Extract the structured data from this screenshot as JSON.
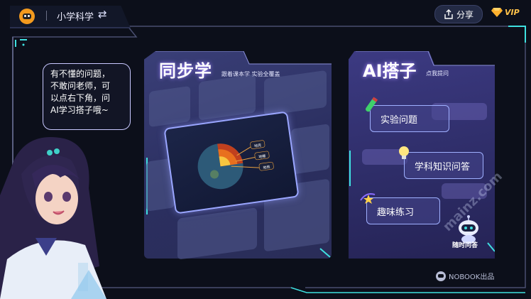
{
  "header": {
    "title": "小学科学",
    "swap_icon": "⇄",
    "share_label": "分享",
    "vip_label": "VIP"
  },
  "bubble": {
    "text": "有不懂的问题，\n不敢问老师，可\n以点右下角，问\n",
    "ai_text": "AI学习搭子哦~"
  },
  "sync": {
    "title": "同步学",
    "subtitle": "跟着课本学 实验全覆盖",
    "earth_labels": [
      "地壳",
      "地幔",
      "地核"
    ]
  },
  "ai": {
    "title": "AI搭子",
    "subtitle": "点我提问",
    "buttons": [
      {
        "label": "实验问题"
      },
      {
        "label": "学科知识问答"
      },
      {
        "label": "趣味练习"
      }
    ],
    "robot_label": "随时问答"
  },
  "footer": {
    "brand": "NOBOOK出品"
  },
  "watermark": "mainz.com",
  "colors": {
    "background": "#0c0f1a",
    "accent_cyan": "#3fe0e0",
    "accent_purple": "#7a5cff",
    "vip_gold": "#ffc24a",
    "test_tube_green": "#3fd06a"
  },
  "icons": {
    "logo": "nobook-logo",
    "share": "share-icon",
    "vip": "diamond-icon",
    "swap": "swap-icon"
  }
}
